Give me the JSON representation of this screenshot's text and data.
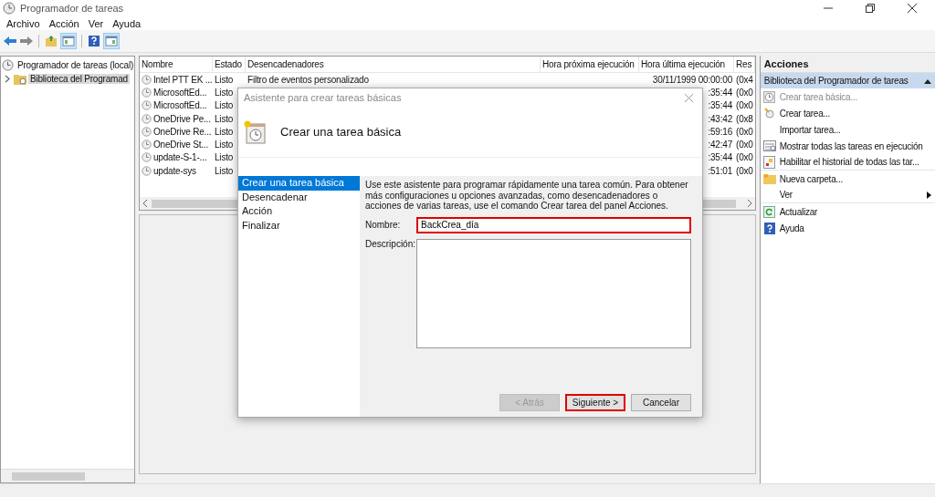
{
  "window": {
    "title": "Programador de tareas"
  },
  "menu": [
    "Archivo",
    "Acción",
    "Ver",
    "Ayuda"
  ],
  "tree": [
    {
      "label": "Programador de tareas (local)",
      "selected": false,
      "children": [
        {
          "label": "Biblioteca del Programad",
          "selected": true,
          "expanded": false
        }
      ]
    }
  ],
  "table": {
    "columns": [
      "Nombre",
      "Estado",
      "Desencadenadores",
      "Hora próxima ejecución",
      "Hora última ejecución",
      "Res"
    ],
    "rows": [
      {
        "name": "Intel PTT EK ...",
        "status": "Listo",
        "trigger": "Filtro de eventos personalizado",
        "last_run": "30/11/1999 00:00:00",
        "result": "(0x4"
      },
      {
        "name": "MicrosoftEd...",
        "status": "Listo",
        "last_run": ":35:44",
        "result": "(0x0"
      },
      {
        "name": "MicrosoftEd...",
        "status": "Listo",
        "last_run": ":35:44",
        "result": "(0x0"
      },
      {
        "name": "OneDrive Pe...",
        "status": "Listo",
        "last_run": ":43:42",
        "result": "(0x8"
      },
      {
        "name": "OneDrive Re...",
        "status": "Listo",
        "last_run": ":59:16",
        "result": "(0x0"
      },
      {
        "name": "OneDrive St...",
        "status": "Listo",
        "last_run": ":42:47",
        "result": "(0x0"
      },
      {
        "name": "update-S-1-...",
        "status": "Listo",
        "last_run": ":35:44",
        "result": "(0x0"
      },
      {
        "name": "update-sys",
        "status": "Listo",
        "last_run": ":51:01",
        "result": "(0x0"
      }
    ]
  },
  "dialog": {
    "title": "Asistente para crear tareas básicas",
    "heading": "Crear una tarea básica",
    "steps": [
      {
        "label": "Crear una tarea básica",
        "selected": true
      },
      {
        "label": "Desencadenar",
        "selected": false
      },
      {
        "label": "Acción",
        "selected": false
      },
      {
        "label": "Finalizar",
        "selected": false
      }
    ],
    "description": "Use este asistente para programar rápidamente una tarea común. Para obtener más configuraciones u opciones avanzadas, como desencadenadores o acciones de varias tareas, use el comando Crear tarea del panel Acciones.",
    "name_label": "Nombre:",
    "name_value": "BackCrea_día",
    "name_highlighted": true,
    "desc_label": "Descripción:",
    "buttons": [
      {
        "label": "< Atrás",
        "disabled": true,
        "highlighted": false
      },
      {
        "label": "Siguiente >",
        "disabled": false,
        "highlighted": true
      },
      {
        "label": "Cancelar",
        "disabled": false,
        "highlighted": false
      }
    ]
  },
  "actions": {
    "title": "Acciones",
    "section": "Biblioteca del Programador de tareas",
    "expanded": true,
    "items": [
      {
        "label": "Crear tarea básica...",
        "kind": "clock",
        "disabled": true,
        "submenu": false,
        "separator_after": false
      },
      {
        "label": "Crear tarea...",
        "kind": "task",
        "disabled": false,
        "submenu": false,
        "separator_after": false
      },
      {
        "label": "Importar tarea...",
        "kind": "none",
        "disabled": false,
        "submenu": false,
        "separator_after": false
      },
      {
        "label": "Mostrar todas las tareas en ejecución",
        "kind": "list",
        "disabled": false,
        "submenu": false,
        "separator_after": false
      },
      {
        "label": "Habilitar el historial de todas las tar...",
        "kind": "history",
        "disabled": false,
        "submenu": false,
        "separator_after": true
      },
      {
        "label": "Nueva carpeta...",
        "kind": "folder",
        "disabled": false,
        "submenu": false,
        "separator_after": false
      },
      {
        "label": "Ver",
        "kind": "none",
        "disabled": false,
        "submenu": true,
        "separator_after": true
      },
      {
        "label": "Actualizar",
        "kind": "refresh",
        "disabled": false,
        "submenu": false,
        "separator_after": false
      },
      {
        "label": "Ayuda",
        "kind": "help",
        "disabled": false,
        "submenu": false,
        "separator_after": false
      }
    ]
  }
}
